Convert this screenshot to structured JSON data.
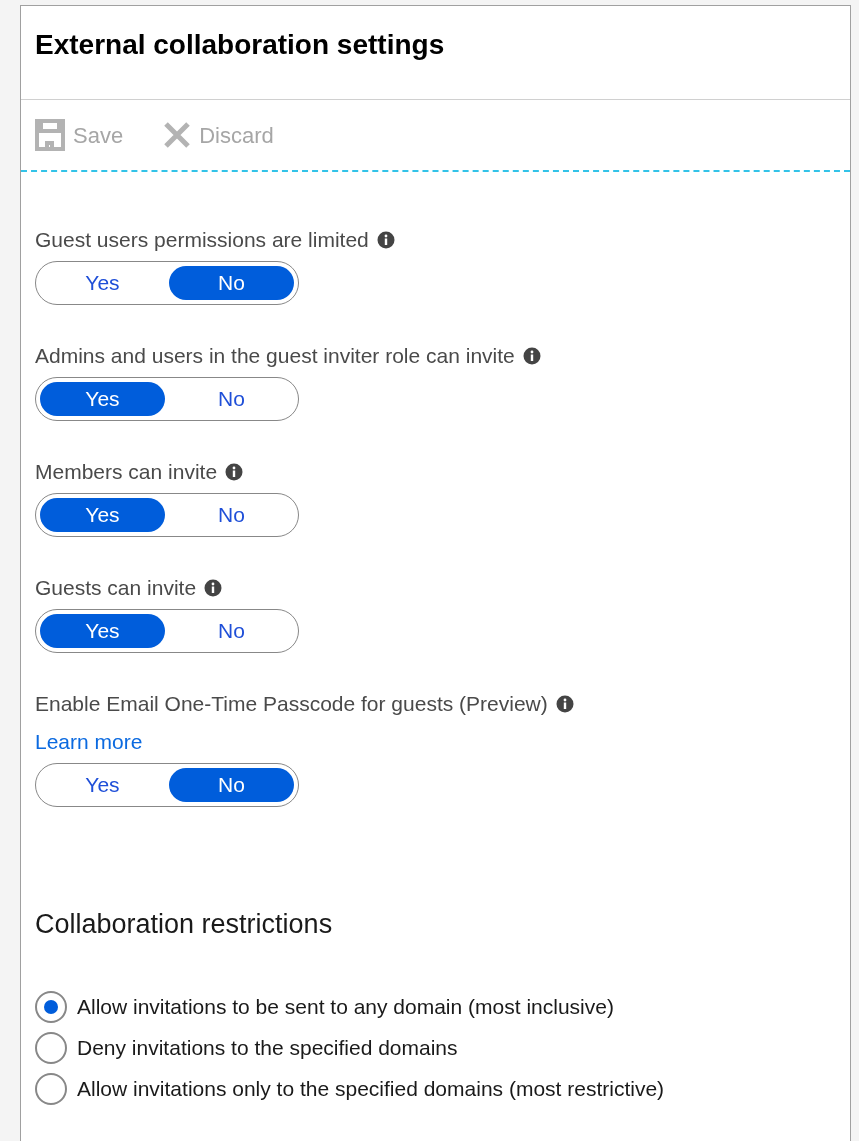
{
  "panel": {
    "title": "External collaboration settings"
  },
  "toolbar": [
    {
      "kind": "save",
      "label": "Save",
      "disabled": true
    },
    {
      "kind": "discard",
      "label": "Discard",
      "disabled": true
    }
  ],
  "settings": [
    {
      "label": "Guest users permissions are limited",
      "options": [
        {
          "label": "Yes",
          "selected": false
        },
        {
          "label": "No",
          "selected": true
        }
      ]
    },
    {
      "label": "Admins and users in the guest inviter role can invite",
      "options": [
        {
          "label": "Yes",
          "selected": true
        },
        {
          "label": "No",
          "selected": false
        }
      ]
    },
    {
      "label": "Members can invite",
      "options": [
        {
          "label": "Yes",
          "selected": true
        },
        {
          "label": "No",
          "selected": false
        }
      ]
    },
    {
      "label": "Guests can invite",
      "options": [
        {
          "label": "Yes",
          "selected": true
        },
        {
          "label": "No",
          "selected": false
        }
      ]
    },
    {
      "label": "Enable Email One-Time Passcode for guests (Preview)",
      "link": "Learn more",
      "options": [
        {
          "label": "Yes",
          "selected": false
        },
        {
          "label": "No",
          "selected": true
        }
      ]
    }
  ],
  "restrictions": {
    "heading": "Collaboration restrictions",
    "options": [
      {
        "label": "Allow invitations to be sent to any domain (most inclusive)",
        "selected": true
      },
      {
        "label": "Deny invitations to the specified domains",
        "selected": false
      },
      {
        "label": "Allow invitations only to the specified domains (most restrictive)",
        "selected": false
      }
    ]
  }
}
